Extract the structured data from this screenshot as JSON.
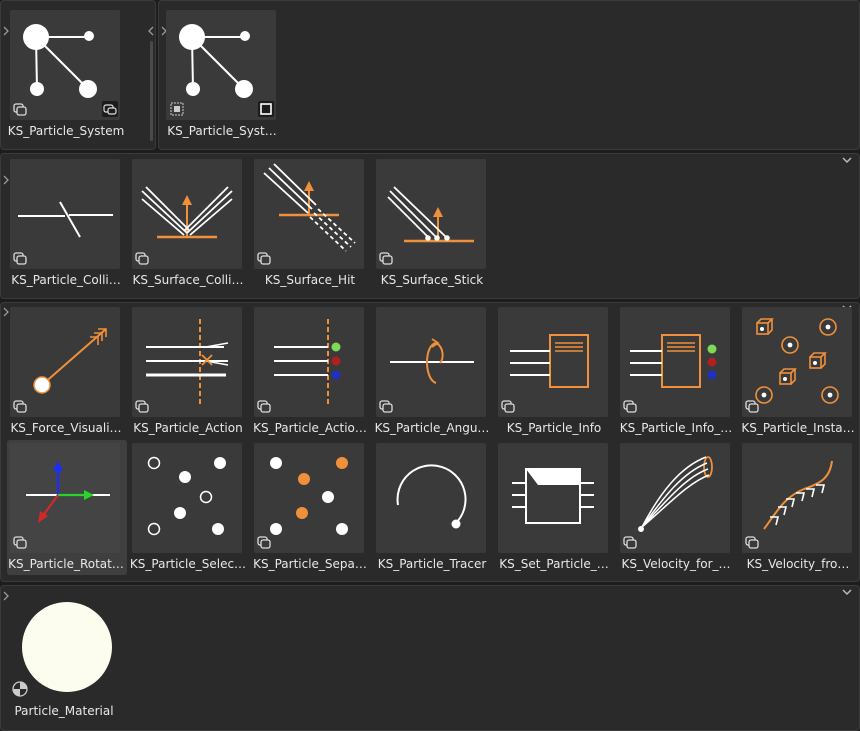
{
  "groups": [
    {
      "id": "g1",
      "items": [
        {
          "label": "KS_Particle_System",
          "icon": "particle-graph-icon"
        },
        {
          "label": "KS_Particle_Syst…",
          "icon": "particle-graph-icon"
        }
      ]
    },
    {
      "id": "g2",
      "items": [
        {
          "label": "KS_Particle_Colli…",
          "icon": "collision-icon"
        },
        {
          "label": "KS_Surface_Colli…",
          "icon": "surface-collision-icon"
        },
        {
          "label": "KS_Surface_Hit",
          "icon": "surface-hit-icon"
        },
        {
          "label": "KS_Surface_Stick",
          "icon": "surface-stick-icon"
        }
      ]
    },
    {
      "id": "g3",
      "items": [
        {
          "label": "KS_Force_Visuali…",
          "icon": "force-vector-icon"
        },
        {
          "label": "KS_Particle_Action",
          "icon": "particle-action-icon"
        },
        {
          "label": "KS_Particle_Actio…",
          "icon": "particle-action-colors-icon"
        },
        {
          "label": "KS_Particle_Angu…",
          "icon": "angular-velocity-icon"
        },
        {
          "label": "KS_Particle_Info",
          "icon": "particle-info-icon"
        },
        {
          "label": "KS_Particle_Info_…",
          "icon": "particle-info-colors-icon"
        },
        {
          "label": "KS_Particle_Insta…",
          "icon": "particle-instance-icon"
        },
        {
          "label": "KS_Particle_Rotat…",
          "icon": "rotation-axes-icon"
        },
        {
          "label": "KS_Particle_Selec…",
          "icon": "particle-select-icon"
        },
        {
          "label": "KS_Particle_Sepa…",
          "icon": "particle-separate-icon"
        },
        {
          "label": "KS_Particle_Tracer",
          "icon": "tracer-icon"
        },
        {
          "label": "KS_Set_Particle_…",
          "icon": "set-particle-icon"
        },
        {
          "label": "KS_Velocity_for_…",
          "icon": "velocity-curves-icon"
        },
        {
          "label": "KS_Velocity_fro…",
          "icon": "velocity-from-icon"
        }
      ]
    },
    {
      "id": "g4",
      "items": [
        {
          "label": "Particle_Material",
          "icon": "material-sphere-icon"
        }
      ]
    }
  ],
  "colors": {
    "accent": "#f0903a",
    "white": "#ffffff",
    "material": "#fdfdef"
  }
}
